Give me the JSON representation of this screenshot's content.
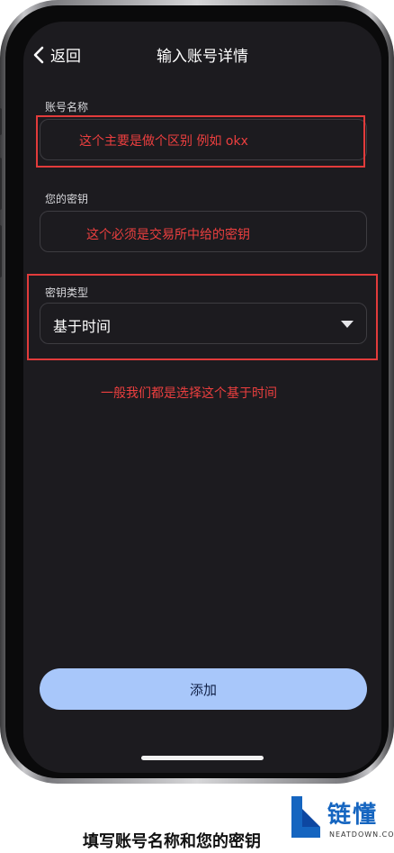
{
  "header": {
    "back_label": "返回",
    "title": "输入账号详情"
  },
  "form": {
    "account_name": {
      "label": "账号名称",
      "value": "",
      "annotation": "这个主要是做个区别 例如 okx"
    },
    "secret_key": {
      "label": "您的密钥",
      "value": "",
      "annotation": "这个必须是交易所中给的密钥"
    },
    "key_type": {
      "label": "密钥类型",
      "selected": "基于时间",
      "annotation": "一般我们都是选择这个基于时间"
    }
  },
  "actions": {
    "add_label": "添加"
  },
  "caption": "填写账号名称和您的密钥",
  "watermark": {
    "name": "链懂",
    "domain": "NEATDOWN.COM"
  },
  "colors": {
    "screen_bg": "#1c1b1f",
    "accent_button": "#a8c7fa",
    "annotation_red": "#e23b3b",
    "watermark_blue": "#1565c0"
  }
}
